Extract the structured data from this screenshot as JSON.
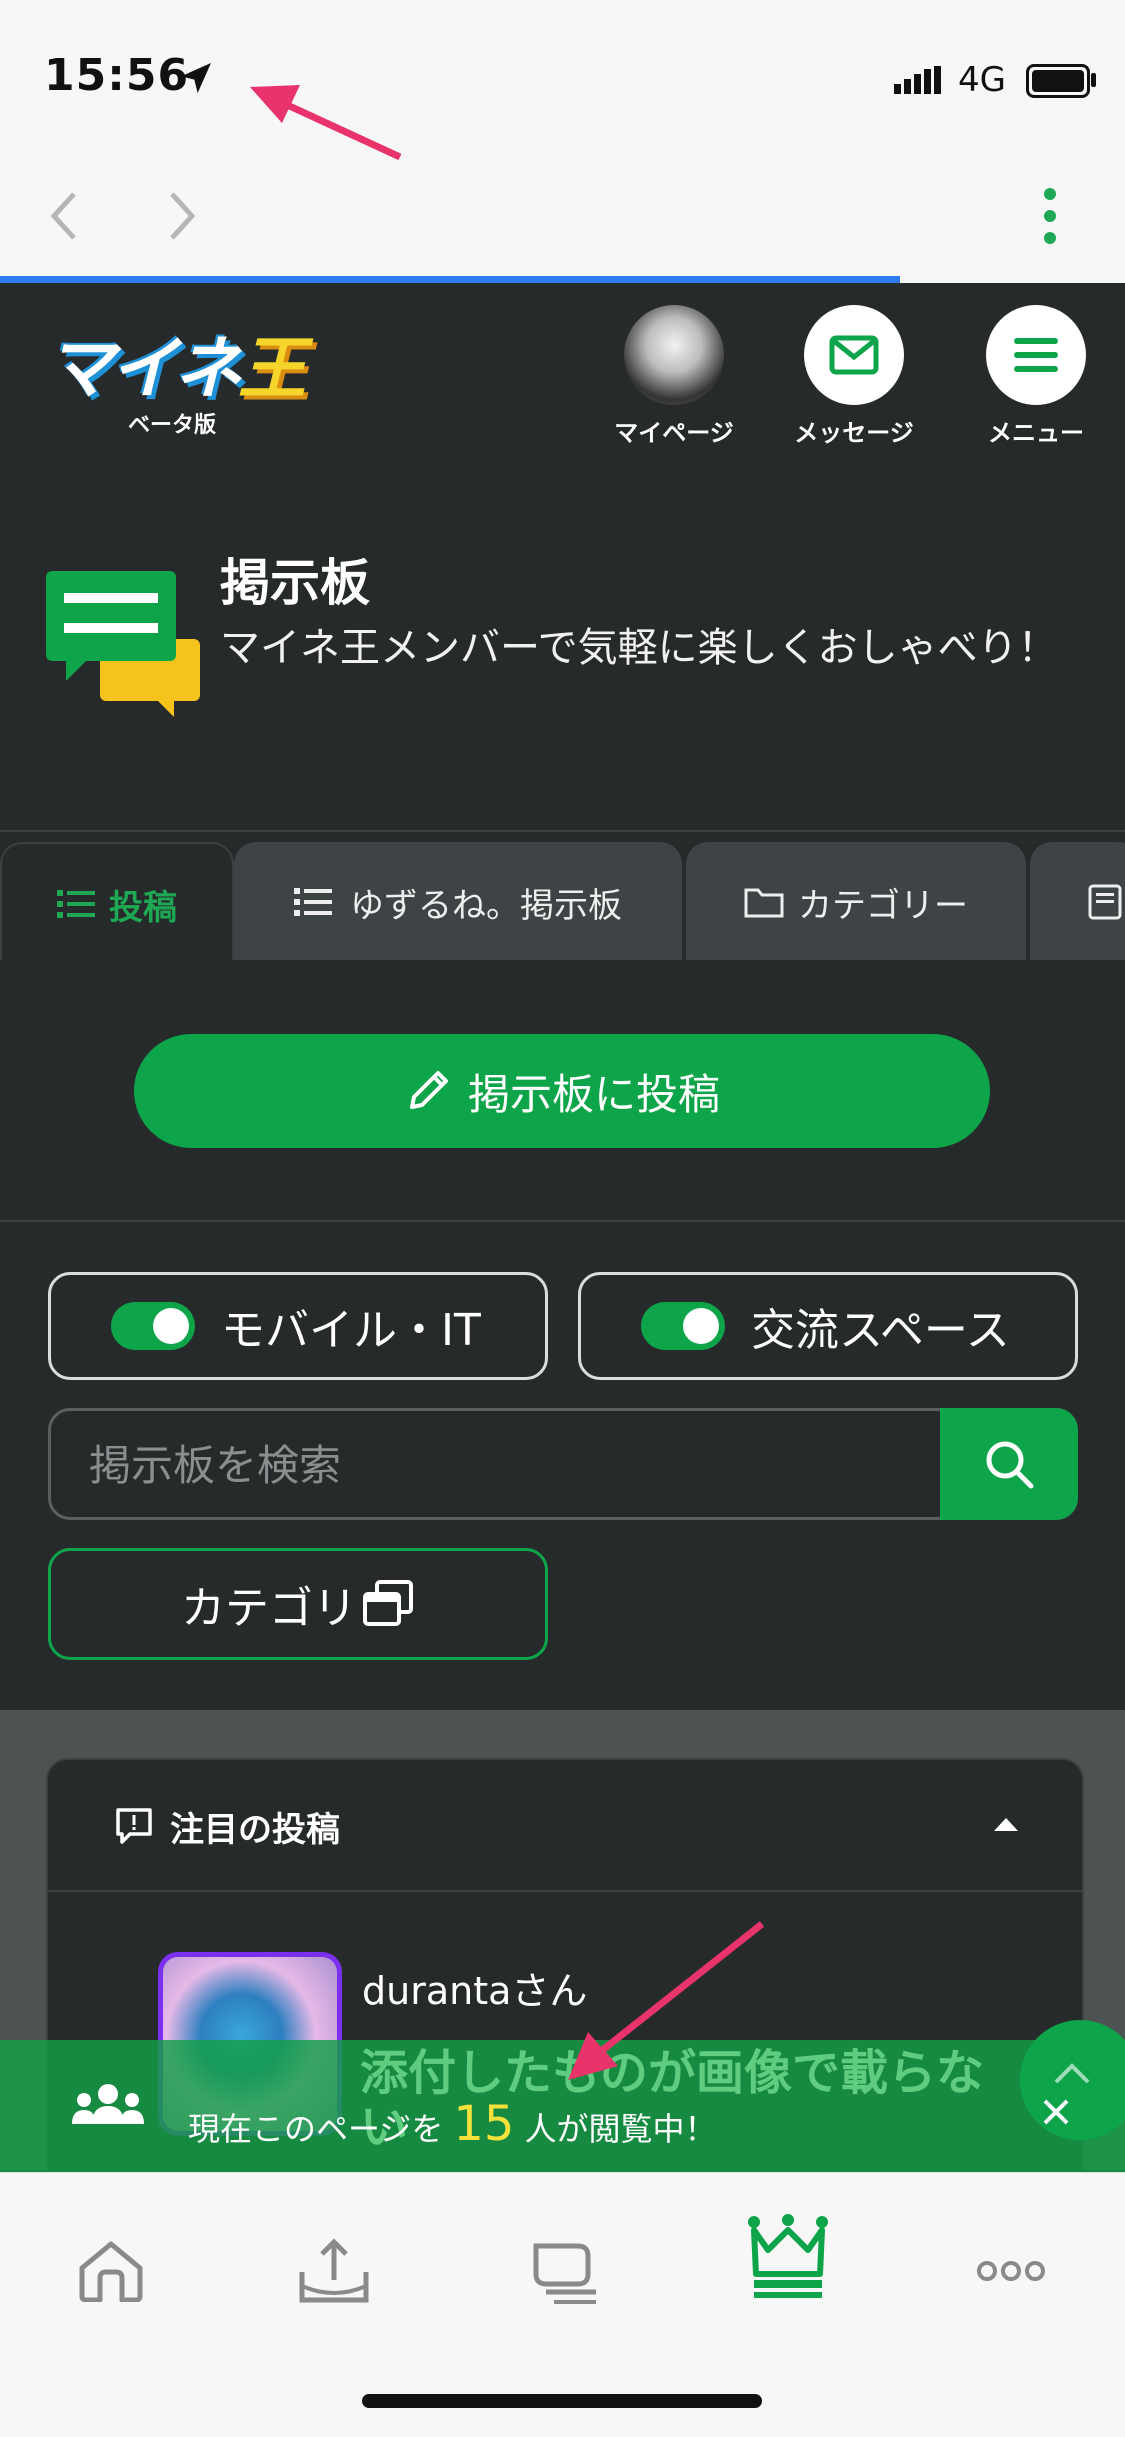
{
  "status_bar": {
    "time": "15:56",
    "network": "4G"
  },
  "header": {
    "logo_main": "マイネ",
    "logo_king": "王",
    "beta_label": "ベータ版",
    "mypage_label": "マイページ",
    "message_label": "メッセージ",
    "menu_label": "メニュー"
  },
  "board": {
    "title": "掲示板",
    "description": "マイネ王メンバーで気軽に楽しくおしゃべり！"
  },
  "tabs": [
    {
      "label": "投稿"
    },
    {
      "label": "ゆずるね。掲示板"
    },
    {
      "label": "カテゴリー"
    }
  ],
  "post_button": {
    "label": "掲示板に投稿"
  },
  "filters": {
    "chip1": "モバイル・IT",
    "chip2": "交流スペース",
    "search_placeholder": "掲示板を検索",
    "category_button": "カテゴリ"
  },
  "featured": {
    "title": "注目の投稿",
    "username": "durantaさん",
    "post_title": "添付したものが画像で載らない"
  },
  "banner": {
    "prefix": "現在このページを",
    "count": "15",
    "suffix": "人が閲覧中！"
  },
  "colors": {
    "accent": "#0ea54a",
    "dark_bg": "#262a2b",
    "annotation_arrow": "#e8336b"
  }
}
